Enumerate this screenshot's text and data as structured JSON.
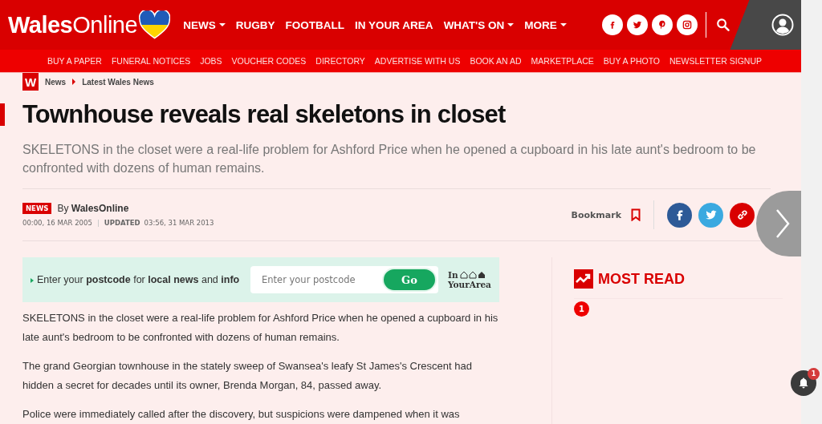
{
  "header": {
    "logo": "**Wales**Online",
    "nav": [
      {
        "label": "NEWS",
        "dropdown": true
      },
      {
        "label": "RUGBY",
        "dropdown": false
      },
      {
        "label": "FOOTBALL",
        "dropdown": false
      },
      {
        "label": "IN YOUR AREA",
        "dropdown": false
      },
      {
        "label": "WHAT'S ON",
        "dropdown": true
      },
      {
        "label": "MORE",
        "dropdown": true
      }
    ],
    "social": [
      {
        "kind": "facebook"
      },
      {
        "kind": "twitter"
      },
      {
        "kind": "pinterest"
      },
      {
        "kind": "instagram"
      }
    ]
  },
  "subnav": [
    "BUY A PAPER",
    "FUNERAL NOTICES",
    "JOBS",
    "VOUCHER CODES",
    "DIRECTORY",
    "ADVERTISE WITH US",
    "BOOK AN AD",
    "MARKETPLACE",
    "BUY A PHOTO",
    "NEWSLETTER SIGNUP"
  ],
  "breadcrumb": {
    "logo": "W",
    "items": [
      "News",
      "Latest Wales News"
    ]
  },
  "article": {
    "title": "Townhouse reveals real skeletons in closet",
    "standfirst": "SKELETONS in the closet were a real-life problem for Ashford Price when he opened a cupboard in his late aunt's bedroom to be confronted with dozens of human remains.",
    "badge": "NEWS",
    "byline": "By **WalesOnline**",
    "published": "00:00, 16 MAR 2005",
    "updated_label": "UPDATED",
    "updated": "03:56, 31 MAR 2013",
    "bookmark": "Bookmark",
    "share": [
      {
        "kind": "facebook"
      },
      {
        "kind": "twitter"
      },
      {
        "kind": "link"
      }
    ],
    "postcode": {
      "text": "Enter your **postcode** for **local news** and **info**",
      "placeholder": "Enter your postcode",
      "button": "Go",
      "brand_top": "In",
      "brand_bottom": "YourArea"
    },
    "paragraphs": [
      "SKELETONS in the closet were a real-life problem for Ashford Price when he opened a cupboard in his late aunt's bedroom to be confronted with dozens of human remains.",
      "The grand Georgian townhouse in the stately sweep of Swansea's leafy St James's Crescent had hidden a secret for decades until its owner, Brenda Morgan, 84, passed away.",
      "Police were immediately called after the discovery, but suspicions were dampened when it was"
    ]
  },
  "most_read": {
    "title": "MOST READ",
    "items": [
      "1"
    ]
  },
  "notifications": {
    "count": "1"
  }
}
